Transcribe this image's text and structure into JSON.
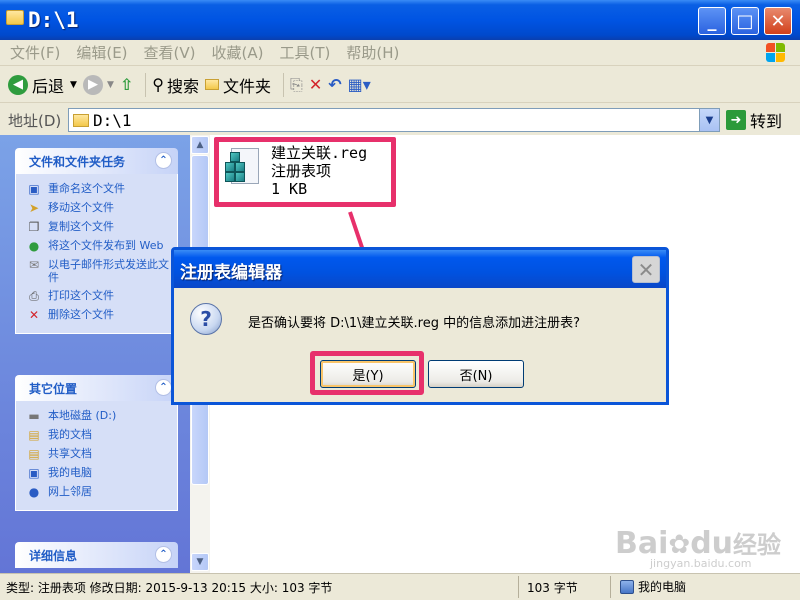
{
  "window": {
    "title": "D:\\1",
    "controls": {
      "minimize": "_",
      "maximize": "□",
      "close": "✕"
    }
  },
  "menu": {
    "items": [
      "文件(F)",
      "编辑(E)",
      "查看(V)",
      "收藏(A)",
      "工具(T)",
      "帮助(H)"
    ]
  },
  "toolbar": {
    "back": "后退",
    "search": "搜索",
    "folders": "文件夹"
  },
  "address": {
    "label": "地址(D)",
    "path": "D:\\1",
    "go": "转到"
  },
  "sidebar": {
    "tasks": {
      "title": "文件和文件夹任务",
      "items": [
        {
          "label": "重命名这个文件",
          "icon": "rename-icon"
        },
        {
          "label": "移动这个文件",
          "icon": "move-icon"
        },
        {
          "label": "复制这个文件",
          "icon": "copy-icon"
        },
        {
          "label": "将这个文件发布到 Web",
          "icon": "web-publish-icon"
        },
        {
          "label": "以电子邮件形式发送此文件",
          "icon": "email-icon"
        },
        {
          "label": "打印这个文件",
          "icon": "print-icon"
        },
        {
          "label": "删除这个文件",
          "icon": "delete-icon"
        }
      ]
    },
    "places": {
      "title": "其它位置",
      "items": [
        {
          "label": "本地磁盘 (D:)",
          "icon": "disk-icon"
        },
        {
          "label": "我的文档",
          "icon": "documents-icon"
        },
        {
          "label": "共享文档",
          "icon": "shared-folder-icon"
        },
        {
          "label": "我的电脑",
          "icon": "computer-icon"
        },
        {
          "label": "网上邻居",
          "icon": "network-icon"
        }
      ]
    },
    "details": {
      "title": "详细信息"
    }
  },
  "file": {
    "name": "建立关联.reg",
    "type": "注册表项",
    "size": "1 KB"
  },
  "dialog": {
    "title": "注册表编辑器",
    "message": "是否确认要将 D:\\1\\建立关联.reg 中的信息添加进注册表?",
    "yes": "是(Y)",
    "no": "否(N)"
  },
  "status": {
    "info": "类型: 注册表项 修改日期: 2015-9-13 20:15 大小: 103 字节",
    "size": "103 字节",
    "location": "我的电脑"
  },
  "watermark": {
    "brand": "Bai",
    "brand2": "du",
    "cn": "经验",
    "url": "jingyan.baidu.com"
  },
  "colors": {
    "highlight": "#E7306B",
    "titlebar": "#0054E3",
    "sidebar": "#7BA2E7"
  }
}
